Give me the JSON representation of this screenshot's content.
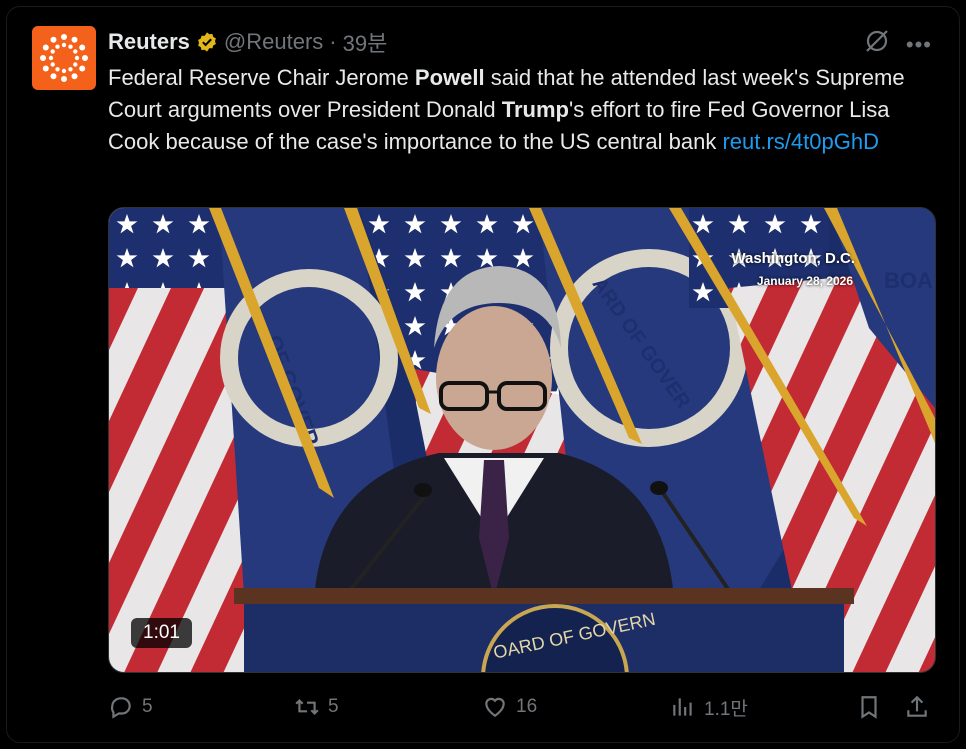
{
  "author": {
    "name": "Reuters",
    "handle": "@Reuters",
    "separator": "·",
    "time": "39분"
  },
  "tweet": {
    "text_parts": [
      "Federal Reserve Chair Jerome ",
      "Powell",
      " said that he attended last week's Supreme Court arguments over President Donald ",
      "Trump",
      "'s effort to fire Fed Governor Lisa Cook because of the case's importance to the US central bank ",
      "reut.rs/4t0pGhD"
    ]
  },
  "media": {
    "duration": "1:01",
    "location": "Washington, D.C.",
    "date": "January 28, 2026",
    "seal_text": "OARD OF GOVERN",
    "flag_seal_text": "OF GOVER",
    "flag_seal_text_2": "ARD OF GOVER",
    "flag_seal_text_3": "BOA"
  },
  "actions": {
    "replies": "5",
    "reposts": "5",
    "likes": "16",
    "views": "1.1만"
  },
  "colors": {
    "accent": "#1d9bf0",
    "brand": "#f4611a",
    "muted": "#71767b",
    "verified": "#e2b719"
  },
  "icons": [
    "sun-logo-icon",
    "verified-badge-icon",
    "grok-icon",
    "more-icon",
    "reply-icon",
    "repost-icon",
    "like-icon",
    "views-icon",
    "bookmark-icon",
    "share-icon"
  ]
}
